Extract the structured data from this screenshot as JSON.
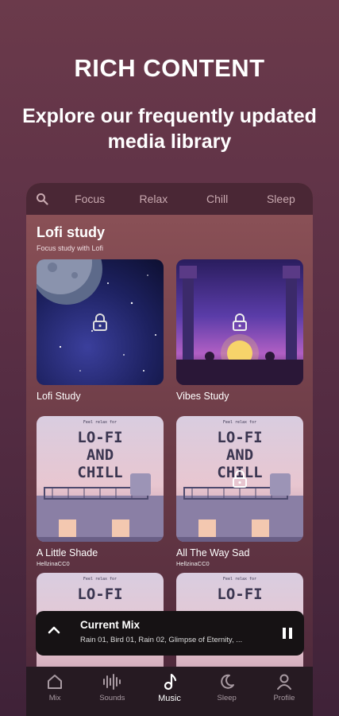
{
  "hero": {
    "title": "RICH CONTENT",
    "subtitle": "Explore our frequently updated media library"
  },
  "tabs": [
    {
      "label": "Focus"
    },
    {
      "label": "Relax"
    },
    {
      "label": "Chill"
    },
    {
      "label": "Sleep"
    }
  ],
  "section": {
    "title": "Lofi study",
    "subtitle": "Focus study with Lofi"
  },
  "cards": [
    {
      "name": "Lofi Study",
      "artist": "",
      "locked": true
    },
    {
      "name": "Vibes Study",
      "artist": "",
      "locked": true
    },
    {
      "name": "A Little Shade",
      "artist": "HellzinaCC0",
      "locked": false
    },
    {
      "name": "All The Way Sad",
      "artist": "HellzinaCC0",
      "locked": true
    }
  ],
  "artwork": {
    "lofi_line1": "LO-FI",
    "lofi_line2": "AND",
    "lofi_line3": "CHILL",
    "lofi_small": "Feel relax for"
  },
  "player": {
    "title": "Current Mix",
    "subtitle": "Rain 01, Bird 01, Rain 02, Glimpse of Eternity, ..."
  },
  "nav": [
    {
      "label": "Mix",
      "icon": "home-icon"
    },
    {
      "label": "Sounds",
      "icon": "waveform-icon"
    },
    {
      "label": "Music",
      "icon": "music-note-icon",
      "active": true
    },
    {
      "label": "Sleep",
      "icon": "moon-icon"
    },
    {
      "label": "Profile",
      "icon": "profile-icon"
    }
  ]
}
